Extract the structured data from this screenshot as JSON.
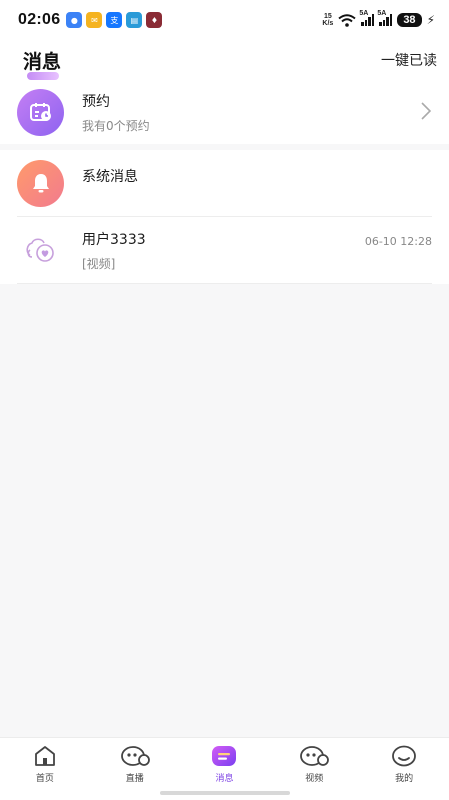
{
  "status_bar": {
    "time": "02:06",
    "net_speed_value": "15",
    "net_speed_unit": "K/s",
    "signal1_label": "5A",
    "signal2_label": "5A",
    "battery": "38",
    "app_icons": [
      "message-app-icon",
      "mail-app-icon",
      "alipay-app-icon",
      "news-app-icon",
      "game-app-icon"
    ]
  },
  "header": {
    "title": "消息",
    "read_all": "一键已读"
  },
  "messages": [
    {
      "name": "预约",
      "sub": "我有0个预约",
      "icon": "calendar-clock-icon"
    },
    {
      "name": "系统消息",
      "sub": "",
      "icon": "bell-icon"
    },
    {
      "name": "用户3333",
      "sub": "[视频]",
      "time": "06-10 12:28",
      "icon": "heart-chat-icon"
    }
  ],
  "bottom_nav": [
    {
      "label": "首页",
      "icon": "home-icon"
    },
    {
      "label": "直播",
      "icon": "live-icon"
    },
    {
      "label": "消息",
      "icon": "message-icon",
      "active": true
    },
    {
      "label": "视频",
      "icon": "video-icon"
    },
    {
      "label": "我的",
      "icon": "profile-icon"
    }
  ],
  "colors": {
    "accent": "#7b3fe4",
    "appointment_gradient": [
      "#c47ff4",
      "#8e63f0"
    ],
    "system_gradient": [
      "#ff9a6b",
      "#f27b8e"
    ]
  }
}
